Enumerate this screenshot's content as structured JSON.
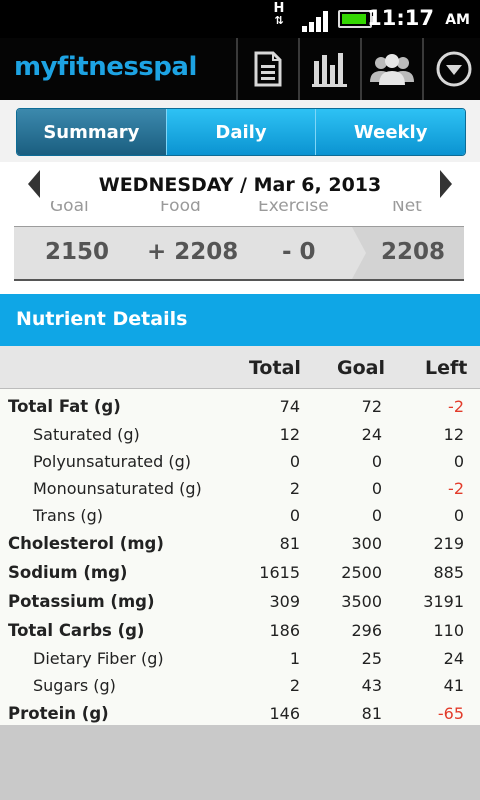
{
  "status": {
    "network": "H",
    "time": "11:17",
    "ampm": "AM"
  },
  "app": {
    "logo": "myfitnesspal",
    "toolbar": [
      "diary-icon",
      "progress-icon",
      "friends-icon",
      "more-icon"
    ]
  },
  "tabs": [
    {
      "label": "Summary",
      "active": true
    },
    {
      "label": "Daily",
      "active": false
    },
    {
      "label": "Weekly",
      "active": false
    }
  ],
  "date": "WEDNESDAY / Mar 6, 2013",
  "summary": {
    "labels": {
      "goal": "Goal",
      "food": "Food",
      "exercise": "Exercise",
      "net": "Net"
    },
    "values": {
      "goal": "2150",
      "food": "+ 2208",
      "exercise": "- 0",
      "net": "2208"
    }
  },
  "nutrient_title": "Nutrient Details",
  "columns": {
    "total": "Total",
    "goal": "Goal",
    "left": "Left"
  },
  "rows": [
    {
      "name": "Total Fat (g)",
      "total": "74",
      "goal": "72",
      "left": "-2",
      "bold": true,
      "indent": false,
      "negative": true
    },
    {
      "name": "Saturated (g)",
      "total": "12",
      "goal": "24",
      "left": "12",
      "bold": false,
      "indent": true,
      "negative": false
    },
    {
      "name": "Polyunsaturated (g)",
      "total": "0",
      "goal": "0",
      "left": "0",
      "bold": false,
      "indent": true,
      "negative": false
    },
    {
      "name": "Monounsaturated (g)",
      "total": "2",
      "goal": "0",
      "left": "-2",
      "bold": false,
      "indent": true,
      "negative": true
    },
    {
      "name": "Trans (g)",
      "total": "0",
      "goal": "0",
      "left": "0",
      "bold": false,
      "indent": true,
      "negative": false
    },
    {
      "name": "Cholesterol (mg)",
      "total": "81",
      "goal": "300",
      "left": "219",
      "bold": true,
      "indent": false,
      "negative": false
    },
    {
      "name": "Sodium (mg)",
      "total": "1615",
      "goal": "2500",
      "left": "885",
      "bold": true,
      "indent": false,
      "negative": false
    },
    {
      "name": "Potassium (mg)",
      "total": "309",
      "goal": "3500",
      "left": "3191",
      "bold": true,
      "indent": false,
      "negative": false
    },
    {
      "name": "Total Carbs (g)",
      "total": "186",
      "goal": "296",
      "left": "110",
      "bold": true,
      "indent": false,
      "negative": false
    },
    {
      "name": "Dietary Fiber (g)",
      "total": "1",
      "goal": "25",
      "left": "24",
      "bold": false,
      "indent": true,
      "negative": false
    },
    {
      "name": "Sugars (g)",
      "total": "2",
      "goal": "43",
      "left": "41",
      "bold": false,
      "indent": true,
      "negative": false
    },
    {
      "name": "Protein (g)",
      "total": "146",
      "goal": "81",
      "left": "-65",
      "bold": true,
      "indent": false,
      "negative": true
    }
  ],
  "colors": {
    "brand": "#1da3e3",
    "tab_active": "#1a5e80",
    "header": "#0fa6e6",
    "negative": "#e23b2a"
  }
}
